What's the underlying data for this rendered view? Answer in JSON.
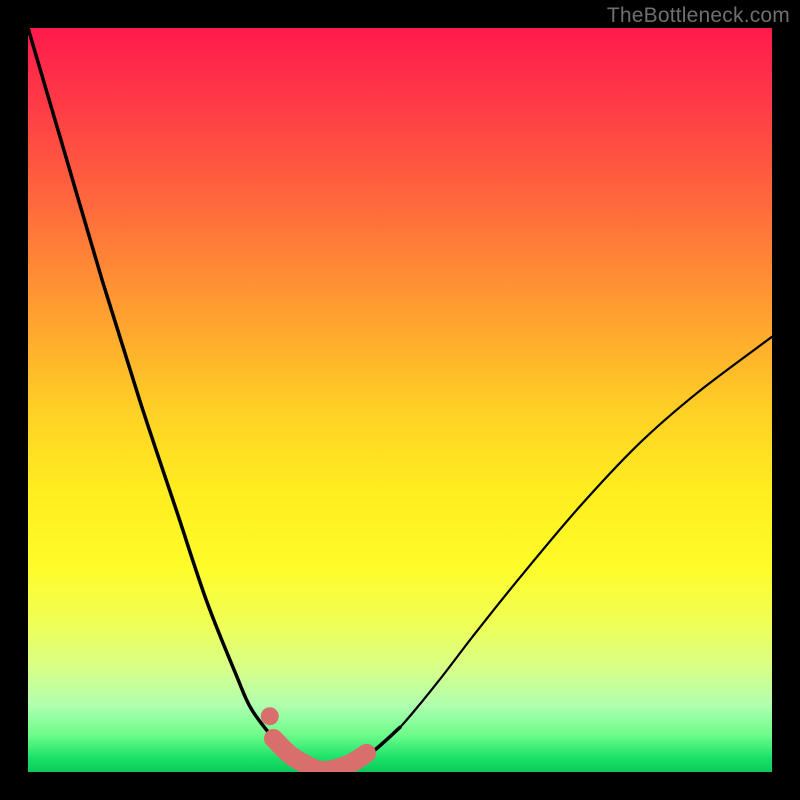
{
  "watermark": "TheBottleneck.com",
  "colors": {
    "page_bg": "#000000",
    "curve": "#000000",
    "accent_pink": "#d96f6c",
    "watermark_text": "#6f6f6f",
    "gradient_stops": [
      {
        "offset": 0.0,
        "color": "#ff1a4d"
      },
      {
        "offset": 0.1,
        "color": "#ff3a46"
      },
      {
        "offset": 0.24,
        "color": "#ff6a3c"
      },
      {
        "offset": 0.38,
        "color": "#ff9e30"
      },
      {
        "offset": 0.52,
        "color": "#ffd225"
      },
      {
        "offset": 0.62,
        "color": "#ffed20"
      },
      {
        "offset": 0.72,
        "color": "#fffb28"
      },
      {
        "offset": 0.8,
        "color": "#f0ff55"
      },
      {
        "offset": 0.86,
        "color": "#d8ff88"
      },
      {
        "offset": 0.91,
        "color": "#b0ffb0"
      },
      {
        "offset": 0.95,
        "color": "#6efc8a"
      },
      {
        "offset": 0.98,
        "color": "#1de36a"
      },
      {
        "offset": 1.0,
        "color": "#0cc95a"
      }
    ]
  },
  "chart_data": {
    "type": "line",
    "title": "",
    "xlabel": "",
    "ylabel": "",
    "xlim": [
      0,
      1
    ],
    "ylim": [
      0,
      1
    ],
    "series": [
      {
        "name": "bottleneck-curve",
        "x": [
          0.0,
          0.05,
          0.1,
          0.15,
          0.2,
          0.24,
          0.28,
          0.3,
          0.33,
          0.35,
          0.37,
          0.395,
          0.42,
          0.46,
          0.5,
          0.55,
          0.6,
          0.66,
          0.74,
          0.82,
          0.9,
          1.0
        ],
        "y": [
          1.0,
          0.83,
          0.66,
          0.5,
          0.35,
          0.23,
          0.13,
          0.085,
          0.045,
          0.025,
          0.012,
          0.002,
          0.005,
          0.025,
          0.06,
          0.12,
          0.185,
          0.26,
          0.355,
          0.44,
          0.51,
          0.585
        ]
      },
      {
        "name": "highlight-band",
        "x": [
          0.33,
          0.35,
          0.37,
          0.395,
          0.43,
          0.455
        ],
        "y": [
          0.045,
          0.025,
          0.012,
          0.002,
          0.01,
          0.025
        ]
      }
    ],
    "markers": [
      {
        "name": "highlight-dot",
        "x": 0.325,
        "y": 0.075
      }
    ]
  }
}
